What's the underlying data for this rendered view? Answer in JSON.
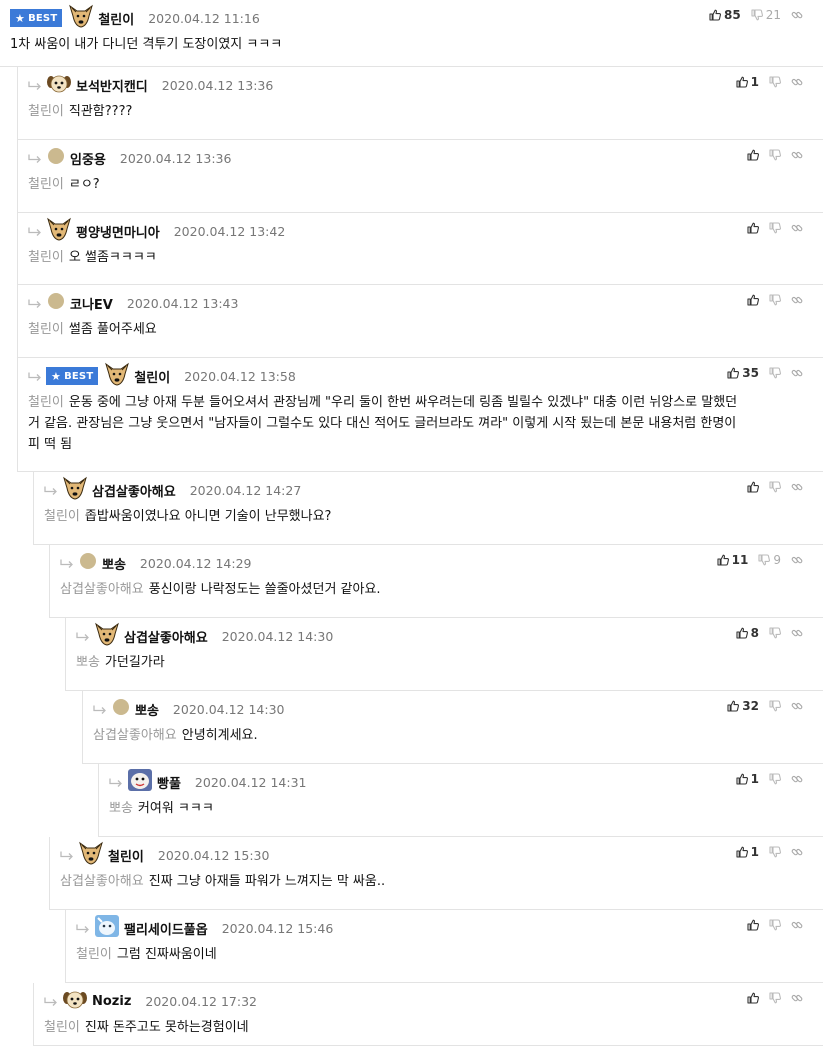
{
  "labels": {
    "best_badge": "BEST"
  },
  "colors": {
    "best_badge_bg": "#3b7ad8",
    "mention_text": "#999999",
    "border": "#e3e3e3"
  },
  "comments": [
    {
      "nickname": "철린이",
      "datetime": "2020.04.12 11:16",
      "best": true,
      "avatar": "dog-avatar",
      "mention": "",
      "text": "1차 싸움이 내가 다니던 격투기 도장이였지 ㅋㅋㅋ",
      "likes": "85",
      "dislikes": "21",
      "depth": 0
    },
    {
      "nickname": "보석반지캔디",
      "datetime": "2020.04.12 13:36",
      "best": false,
      "avatar": "puppy-avatar",
      "mention": "철린이",
      "text": "직관함????",
      "likes": "1",
      "dislikes": "",
      "depth": 1
    },
    {
      "nickname": "임중용",
      "datetime": "2020.04.12 13:36",
      "best": false,
      "avatar": "default-avatar",
      "mention": "철린이",
      "text": "ㄹㅇ?",
      "likes": "",
      "dislikes": "",
      "depth": 1
    },
    {
      "nickname": "평양냉면마니아",
      "datetime": "2020.04.12 13:42",
      "best": false,
      "avatar": "dog-avatar",
      "mention": "철린이",
      "text": "오 썰좀ㅋㅋㅋㅋ",
      "likes": "",
      "dislikes": "",
      "depth": 1
    },
    {
      "nickname": "코나EV",
      "datetime": "2020.04.12 13:43",
      "best": false,
      "avatar": "default-avatar",
      "mention": "철린이",
      "text": "썰좀 풀어주세요",
      "likes": "",
      "dislikes": "",
      "depth": 1
    },
    {
      "nickname": "철린이",
      "datetime": "2020.04.12 13:58",
      "best": true,
      "avatar": "dog-avatar",
      "mention": "철린이",
      "lines": [
        "운동 중에 그냥 아재 두분 들어오셔서 관장님께 \"우리 둘이 한번 싸우려는데 링좀 빌릴수 있겠냐\" 대충 이런 뉘앙스로 말했던",
        "거 같음. 관장님은 그냥 웃으면서 \"남자들이 그럴수도 있다 대신 적어도 글러브라도 껴라\" 이렇게 시작 됬는데 본문 내용처럼 한명이",
        "피 떡 됨"
      ],
      "likes": "35",
      "dislikes": "",
      "depth": 1
    },
    {
      "nickname": "삼겹살좋아해요",
      "datetime": "2020.04.12 14:27",
      "best": false,
      "avatar": "dog-avatar",
      "mention": "철린이",
      "text": "좁밥싸움이였나요 아니면 기술이 난무했나요?",
      "likes": "",
      "dislikes": "",
      "depth": 2
    },
    {
      "nickname": "뽀송",
      "datetime": "2020.04.12 14:29",
      "best": false,
      "avatar": "default-avatar",
      "mention": "삼겹살좋아해요",
      "text": "풍신이랑 나락정도는 쓸줄아셨던거 같아요.",
      "likes": "11",
      "dislikes": "9",
      "depth": 3
    },
    {
      "nickname": "삼겹살좋아해요",
      "datetime": "2020.04.12 14:30",
      "best": false,
      "avatar": "dog-avatar",
      "mention": "뽀송",
      "text": "가던길가라",
      "likes": "8",
      "dislikes": "",
      "depth": 4
    },
    {
      "nickname": "뽀송",
      "datetime": "2020.04.12 14:30",
      "best": false,
      "avatar": "default-avatar",
      "mention": "삼겹살좋아해요",
      "text": "안녕히계세요.",
      "likes": "32",
      "dislikes": "",
      "depth": 5
    },
    {
      "nickname": "빵풀",
      "datetime": "2020.04.12 14:31",
      "best": false,
      "avatar": "cartoon-avatar",
      "mention": "뽀송",
      "text": "커여워 ㅋㅋㅋ",
      "likes": "1",
      "dislikes": "",
      "depth": 6
    },
    {
      "nickname": "철린이",
      "datetime": "2020.04.12 15:30",
      "best": false,
      "avatar": "dog-avatar",
      "mention": "삼겹살좋아해요",
      "text": "진짜 그냥 아재들 파워가 느껴지는 막 싸움..",
      "likes": "1",
      "dislikes": "",
      "depth": 3
    },
    {
      "nickname": "팰리세이드풀옵",
      "datetime": "2020.04.12 15:46",
      "best": false,
      "avatar": "blue-avatar",
      "mention": "철린이",
      "text": "그럼 진짜싸움이네",
      "likes": "",
      "dislikes": "",
      "depth": 4
    },
    {
      "nickname": "Noziz",
      "datetime": "2020.04.12 17:32",
      "best": false,
      "avatar": "puppy-avatar",
      "mention": "철린이",
      "text": "진짜 돈주고도 못하는경험이네",
      "likes": "",
      "dislikes": "",
      "depth": 2
    }
  ]
}
